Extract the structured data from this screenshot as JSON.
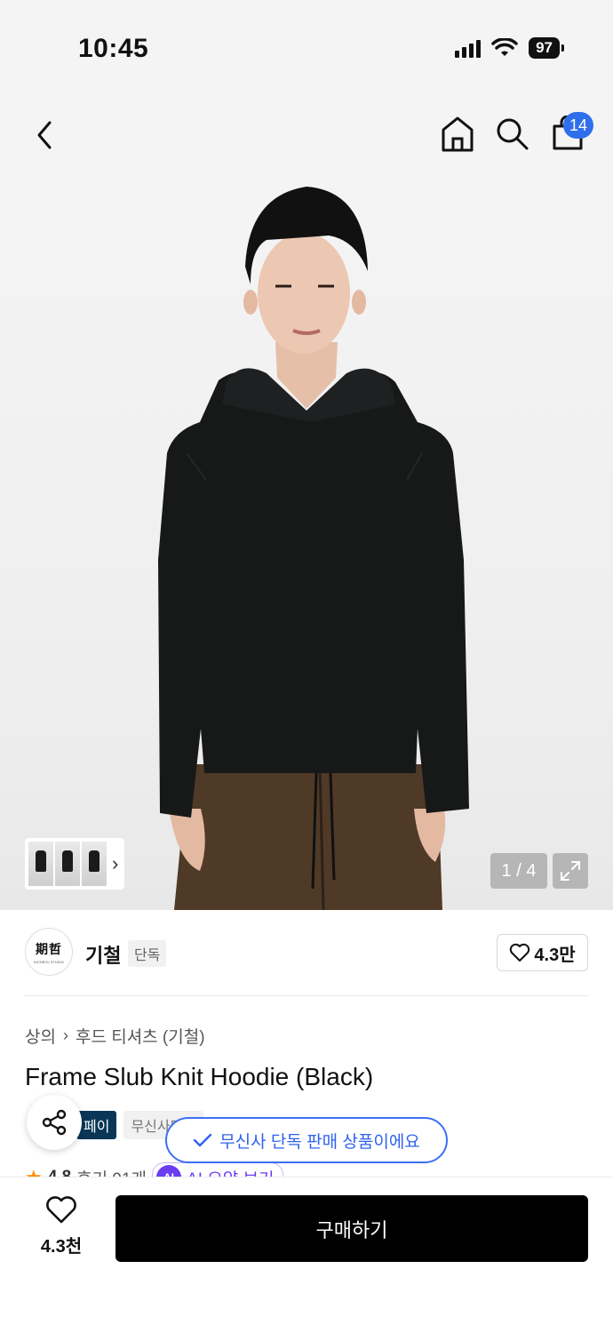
{
  "status": {
    "time": "10:45",
    "battery": "97"
  },
  "nav": {
    "cart_count": "14"
  },
  "gallery": {
    "counter": "1 / 4"
  },
  "brand": {
    "logo_chars": "期哲",
    "logo_sub": "KICHEOL STUDIO",
    "name": "기철",
    "tag": "단독",
    "likes": "4.3만"
  },
  "product": {
    "breadcrumb": [
      "상의",
      "후드 티셔츠 (기철)"
    ],
    "title": "Frame Slub Knit Hoodie (Black)",
    "tags": [
      "페이",
      "무신사단독"
    ],
    "rating": "4.8",
    "reviews": "후기 91개",
    "ai_label": "AI",
    "ai_summary": "AI 요약 보기"
  },
  "toast": {
    "text": "무신사 단독 판매 상품이에요"
  },
  "bottom": {
    "wish_count": "4.3천",
    "buy_label": "구매하기"
  },
  "colors": {
    "accent": "#2f6fec",
    "buy": "#000000",
    "tag_dark": "#0a3757",
    "star": "#ff8a00",
    "ai": "#6b3cf0"
  }
}
